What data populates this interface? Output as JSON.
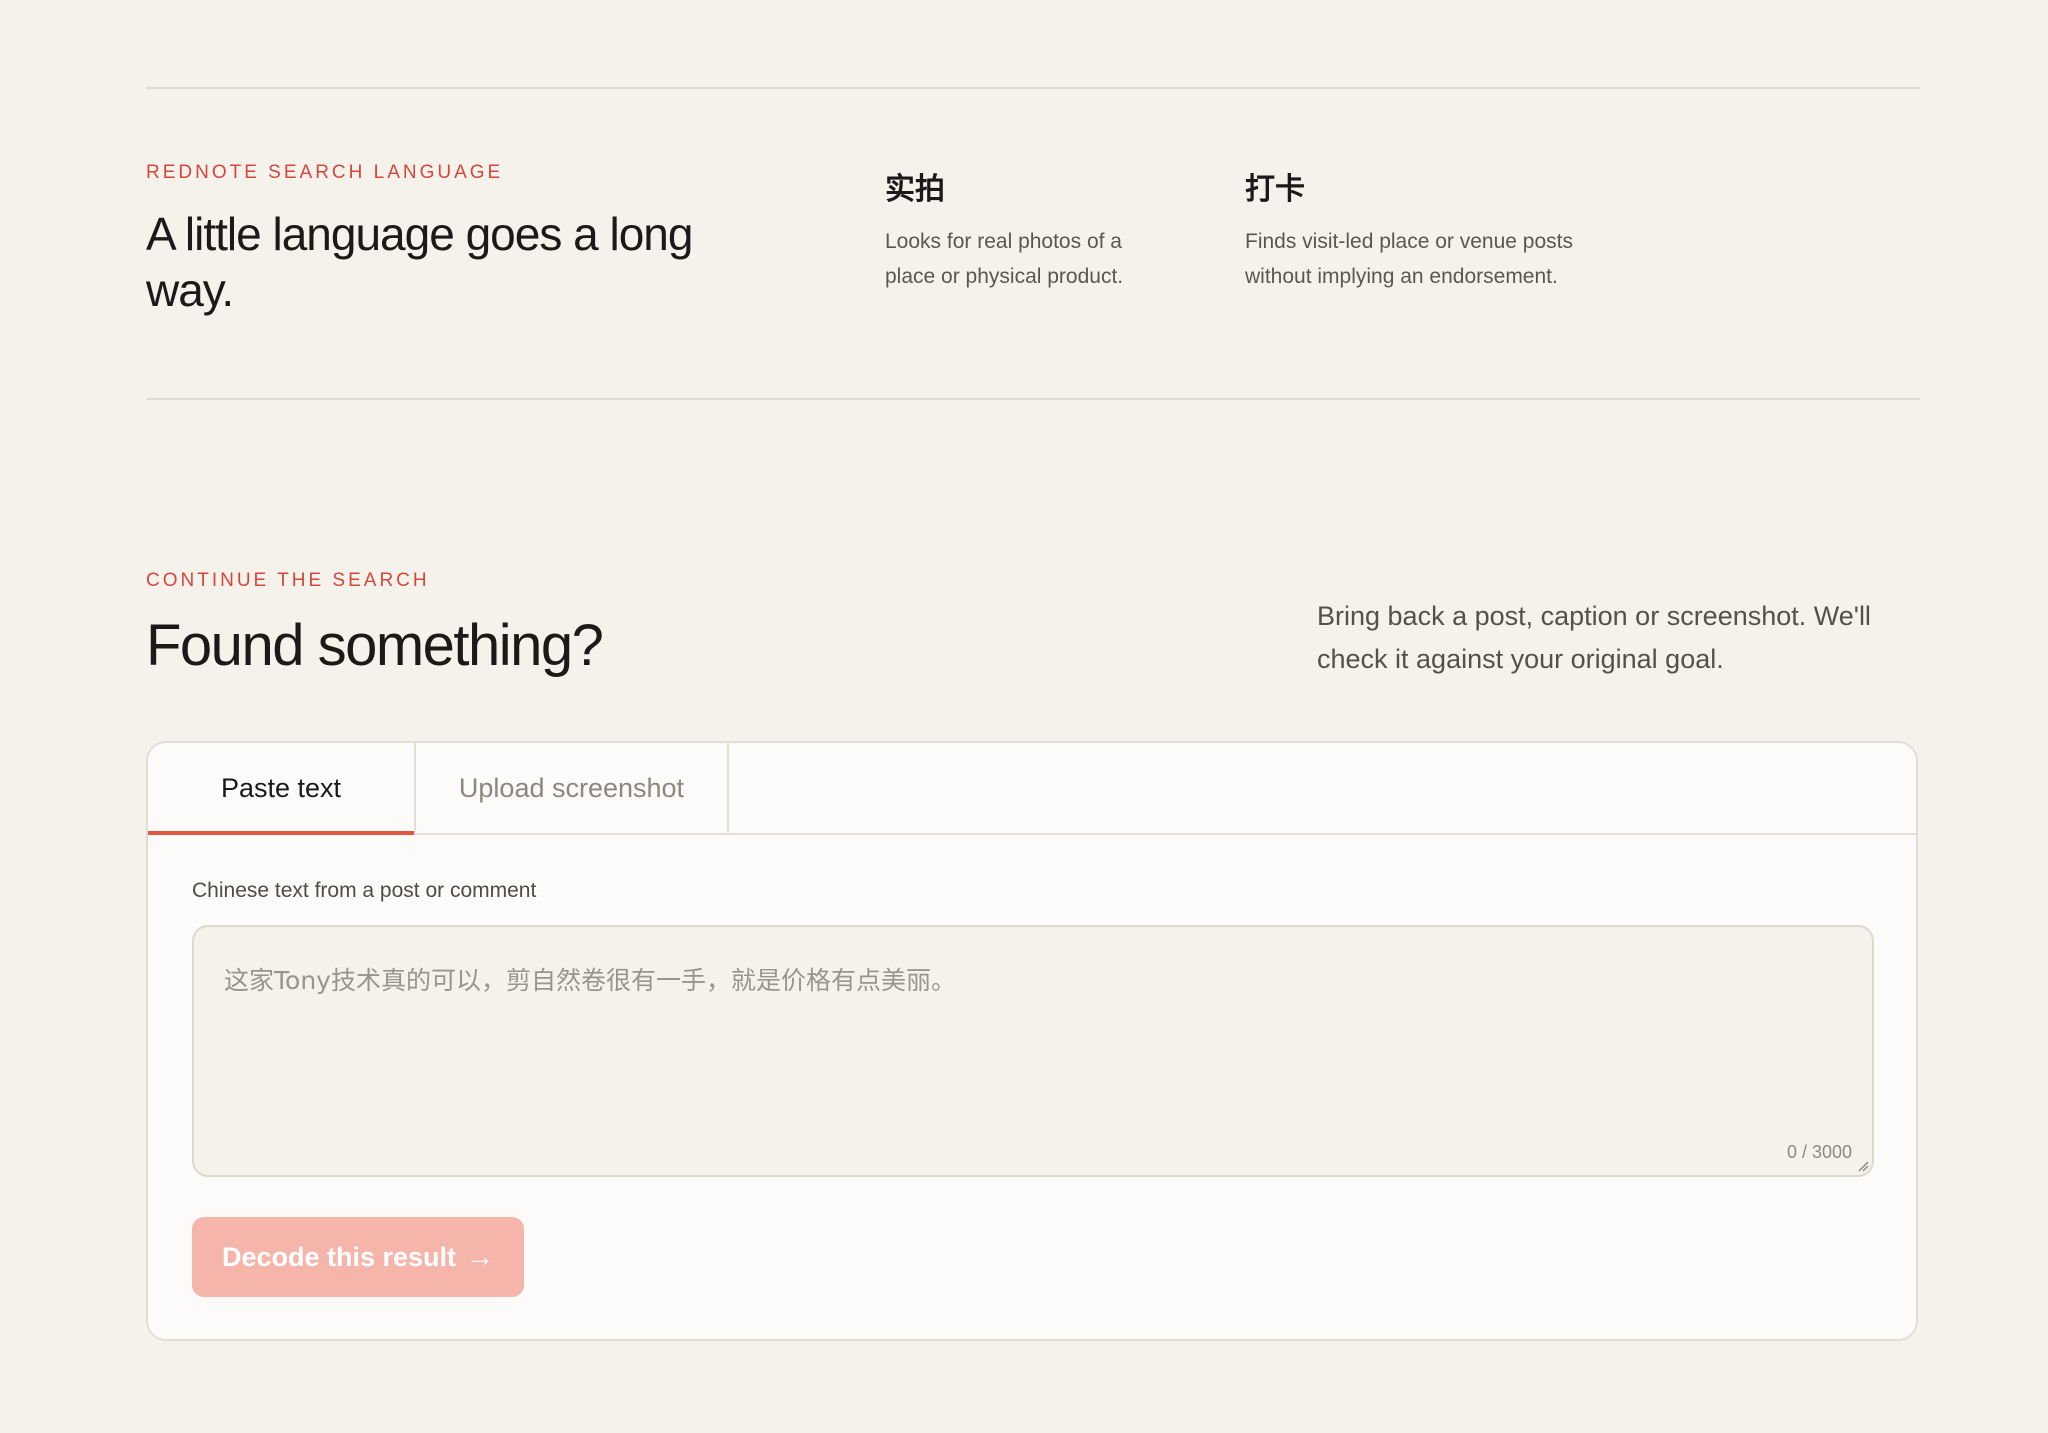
{
  "language_section": {
    "eyebrow": "REDNOTE SEARCH LANGUAGE",
    "headline": "A little language goes a long way.",
    "terms": [
      {
        "term": "实拍",
        "description": "Looks for real photos of a place or physical product."
      },
      {
        "term": "打卡",
        "description": "Finds visit-led place or venue posts without implying an endorsement."
      }
    ]
  },
  "continue_section": {
    "eyebrow": "CONTINUE THE SEARCH",
    "headline": "Found something?",
    "intro": "Bring back a post, caption or screenshot. We'll check it against your original goal."
  },
  "decoder": {
    "tabs": [
      {
        "label": "Paste text",
        "active": true
      },
      {
        "label": "Upload screenshot",
        "active": false
      }
    ],
    "field_label": "Chinese text from a post or comment",
    "placeholder": "这家Tony技术真的可以，剪自然卷很有一手，就是价格有点美丽。",
    "counter": "0 / 3000",
    "button_label": "Decode this result",
    "button_arrow": "→"
  },
  "colors": {
    "background": "#f5f2ec",
    "accent": "#d4473a",
    "tab_underline": "#e0573f",
    "button_disabled": "#f5b5aa"
  }
}
